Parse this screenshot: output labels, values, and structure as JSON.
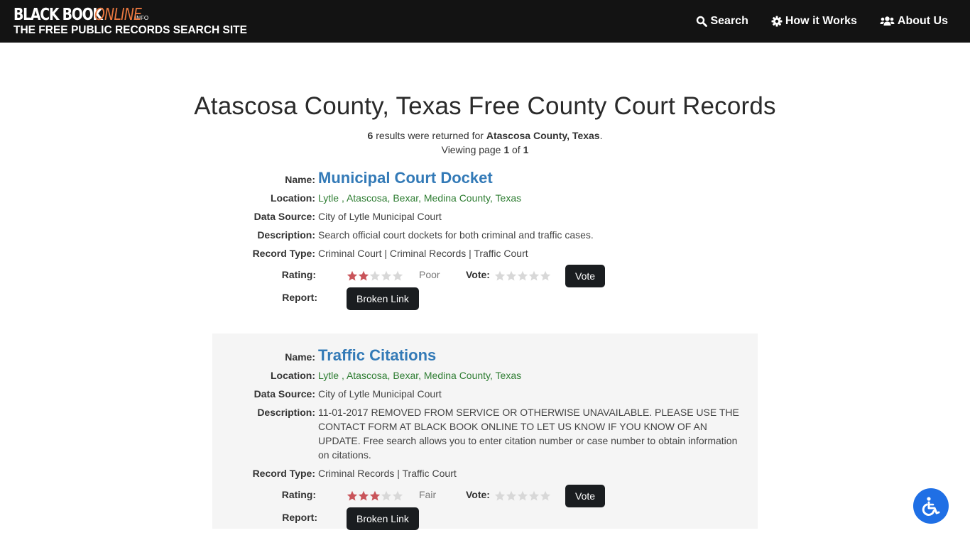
{
  "header": {
    "logo_black": "BLACK BOOK",
    "logo_online": "ONLINE",
    "logo_info": ".INFO",
    "logo_tagline": "THE FREE PUBLIC RECORDS SEARCH SITE",
    "nav": [
      {
        "label": "Search",
        "icon": "search-icon"
      },
      {
        "label": "How it Works",
        "icon": "gear-icon"
      },
      {
        "label": "About Us",
        "icon": "users-icon"
      }
    ]
  },
  "page": {
    "title": "Atascosa County, Texas Free County Court Records",
    "result_count": "6",
    "results_text": " results were returned for ",
    "query": "Atascosa County, Texas",
    "period": ".",
    "viewing_text": "Viewing page ",
    "page_current": "1",
    "of_text": " of ",
    "page_total": "1"
  },
  "labels": {
    "name": "Name:",
    "location": "Location:",
    "data_source": "Data Source:",
    "description": "Description:",
    "record_type": "Record Type:",
    "rating": "Rating:",
    "vote": "Vote:",
    "report": "Report:",
    "vote_button": "Vote",
    "broken_link_button": "Broken Link"
  },
  "colors": {
    "star_filled": "#c9545a",
    "star_empty": "#d8d8d8",
    "link": "#337ab7",
    "location": "#2e7d32",
    "accent_orange": "#e8773f",
    "accessibility_blue": "#1f6fe5"
  },
  "results": [
    {
      "name": "Municipal Court Docket",
      "location": "Lytle , Atascosa, Bexar, Medina County, Texas",
      "data_source": "City of Lytle Municipal Court",
      "description": "Search official court dockets for both criminal and traffic cases.",
      "record_type": "Criminal Court | Criminal Records | Traffic Court",
      "rating_stars": 2,
      "rating_max": 5,
      "rating_text": "Poor",
      "vote_stars": 0
    },
    {
      "name": "Traffic Citations",
      "location": "Lytle , Atascosa, Bexar, Medina County, Texas",
      "data_source": "City of Lytle Municipal Court",
      "description": "11-01-2017 REMOVED FROM SERVICE OR OTHERWISE UNAVAILABLE. PLEASE USE THE CONTACT FORM AT BLACK BOOK ONLINE TO LET US KNOW IF YOU KNOW OF AN UPDATE. Free search allows you to enter citation number or case number to obtain information on citations.",
      "record_type": "Criminal Records | Traffic Court",
      "rating_stars": 3,
      "rating_max": 5,
      "rating_text": "Fair",
      "vote_stars": 0
    }
  ],
  "accessibility": {
    "icon": "wheelchair-icon"
  }
}
